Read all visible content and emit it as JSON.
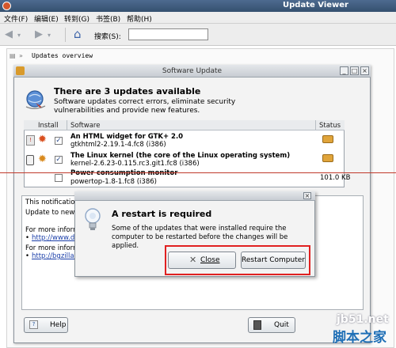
{
  "window": {
    "title": "Update Viewer"
  },
  "menu": [
    "文件(F)",
    "编辑(E)",
    "转到(G)",
    "书签(B)",
    "帮助(H)"
  ],
  "toolbar": {
    "search_label": "搜索(S):",
    "search_value": ""
  },
  "overview_title": "Updates overview",
  "update_dialog": {
    "title": "Software Update",
    "heading": "There are 3 updates available",
    "description": "Software updates correct errors, eliminate security vulnerabilities and provide new features.",
    "columns": {
      "install": "Install",
      "software": "Software",
      "status": "Status"
    },
    "rows": [
      {
        "name": "An HTML widget for GTK+ 2.0",
        "package": "gtkhtml2-2.19.1-4.fc8 (i386)",
        "status": "",
        "checked": true
      },
      {
        "name": "The Linux kernel (the core of the Linux operating system)",
        "package": "kernel-2.6.23-0.115.rc3.git1.fc8 (i386)",
        "status": "",
        "checked": true
      },
      {
        "name": "Power consumption monitor",
        "package": "powertop-1.8-1.fc8 (i386)",
        "status": "101.0 KB",
        "checked": false
      }
    ],
    "info": {
      "line1": "This notification",
      "line2": "Update to newe",
      "line3": "For more inform",
      "link1": "http://www.di",
      "line4": "For more inform",
      "link2": "http://bgzilla."
    },
    "help_label": "Help",
    "quit_label": "Quit"
  },
  "restart_dialog": {
    "heading": "A restart is required",
    "message": "Some of the updates that were installed require the computer to be restarted before the changes will be applied.",
    "close_label": "Close",
    "restart_label": "Restart Computer"
  },
  "watermark": {
    "line1": "jb51.net",
    "line2": "脚本之家"
  },
  "colors": {
    "titlebar": "#35506f",
    "highlight": "#e02020",
    "link": "#1a3ea8"
  }
}
